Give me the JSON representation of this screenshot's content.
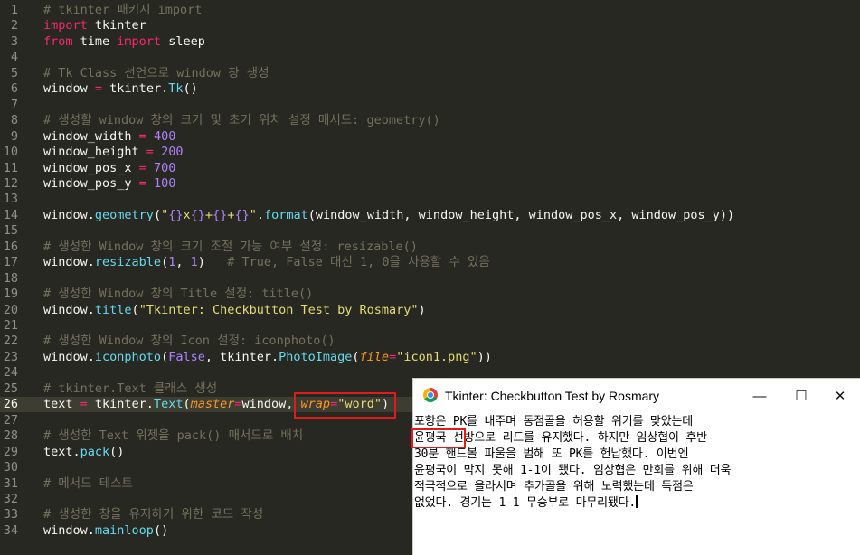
{
  "editor": {
    "line_numbers": [
      "1",
      "2",
      "3",
      "4",
      "5",
      "6",
      "7",
      "8",
      "9",
      "10",
      "11",
      "12",
      "13",
      "14",
      "15",
      "16",
      "17",
      "18",
      "19",
      "20",
      "21",
      "22",
      "23",
      "24",
      "25",
      "26",
      "27",
      "28",
      "29",
      "30",
      "31",
      "32",
      "33",
      "34"
    ],
    "active_line": 26,
    "lines": [
      [
        {
          "c": "c",
          "t": "# tkinter 패키지 import"
        }
      ],
      [
        {
          "c": "k",
          "t": "import"
        },
        {
          "c": "p",
          "t": " tkinter"
        }
      ],
      [
        {
          "c": "k",
          "t": "from"
        },
        {
          "c": "p",
          "t": " time "
        },
        {
          "c": "k",
          "t": "import"
        },
        {
          "c": "p",
          "t": " sleep"
        }
      ],
      [],
      [
        {
          "c": "c",
          "t": "# Tk Class 선언으로 window 창 생성"
        }
      ],
      [
        {
          "c": "p",
          "t": "window "
        },
        {
          "c": "k",
          "t": "="
        },
        {
          "c": "p",
          "t": " tkinter."
        },
        {
          "c": "f",
          "t": "Tk"
        },
        {
          "c": "p",
          "t": "()"
        }
      ],
      [],
      [
        {
          "c": "c",
          "t": "# 생성할 window 창의 크기 및 초기 위치 설정 매서드: geometry()"
        }
      ],
      [
        {
          "c": "p",
          "t": "window_width "
        },
        {
          "c": "k",
          "t": "="
        },
        {
          "c": "p",
          "t": " "
        },
        {
          "c": "n",
          "t": "400"
        }
      ],
      [
        {
          "c": "p",
          "t": "window_height "
        },
        {
          "c": "k",
          "t": "="
        },
        {
          "c": "p",
          "t": " "
        },
        {
          "c": "n",
          "t": "200"
        }
      ],
      [
        {
          "c": "p",
          "t": "window_pos_x "
        },
        {
          "c": "k",
          "t": "="
        },
        {
          "c": "p",
          "t": " "
        },
        {
          "c": "n",
          "t": "700"
        }
      ],
      [
        {
          "c": "p",
          "t": "window_pos_y "
        },
        {
          "c": "k",
          "t": "="
        },
        {
          "c": "p",
          "t": " "
        },
        {
          "c": "n",
          "t": "100"
        }
      ],
      [],
      [
        {
          "c": "p",
          "t": "window."
        },
        {
          "c": "f",
          "t": "geometry"
        },
        {
          "c": "p",
          "t": "("
        },
        {
          "c": "s",
          "t": "\""
        },
        {
          "c": "n",
          "t": "{}"
        },
        {
          "c": "s",
          "t": "x"
        },
        {
          "c": "n",
          "t": "{}"
        },
        {
          "c": "s",
          "t": "+"
        },
        {
          "c": "n",
          "t": "{}"
        },
        {
          "c": "s",
          "t": "+"
        },
        {
          "c": "n",
          "t": "{}"
        },
        {
          "c": "s",
          "t": "\""
        },
        {
          "c": "p",
          "t": "."
        },
        {
          "c": "f",
          "t": "format"
        },
        {
          "c": "p",
          "t": "(window_width, window_height, window_pos_x, window_pos_y))"
        }
      ],
      [],
      [
        {
          "c": "c",
          "t": "# 생성한 Window 창의 크기 조절 가능 여부 설정: resizable()"
        }
      ],
      [
        {
          "c": "p",
          "t": "window."
        },
        {
          "c": "f",
          "t": "resizable"
        },
        {
          "c": "p",
          "t": "("
        },
        {
          "c": "n",
          "t": "1"
        },
        {
          "c": "p",
          "t": ", "
        },
        {
          "c": "n",
          "t": "1"
        },
        {
          "c": "p",
          "t": ")   "
        },
        {
          "c": "c",
          "t": "# True, False 대신 1, 0을 사용할 수 있음"
        }
      ],
      [],
      [
        {
          "c": "c",
          "t": "# 생성한 Window 창의 Title 설정: title()"
        }
      ],
      [
        {
          "c": "p",
          "t": "window."
        },
        {
          "c": "f",
          "t": "title"
        },
        {
          "c": "p",
          "t": "("
        },
        {
          "c": "s",
          "t": "\"Tkinter: Checkbutton Test by Rosmary\""
        },
        {
          "c": "p",
          "t": ")"
        }
      ],
      [],
      [
        {
          "c": "c",
          "t": "# 생성한 Window 창의 Icon 설정: iconphoto()"
        }
      ],
      [
        {
          "c": "p",
          "t": "window."
        },
        {
          "c": "f",
          "t": "iconphoto"
        },
        {
          "c": "p",
          "t": "("
        },
        {
          "c": "n",
          "t": "False"
        },
        {
          "c": "p",
          "t": ", tkinter."
        },
        {
          "c": "f",
          "t": "PhotoImage"
        },
        {
          "c": "p",
          "t": "("
        },
        {
          "c": "a",
          "t": "file"
        },
        {
          "c": "k",
          "t": "="
        },
        {
          "c": "s",
          "t": "\"icon1.png\""
        },
        {
          "c": "p",
          "t": "))"
        }
      ],
      [],
      [
        {
          "c": "c",
          "t": "# tkinter.Text 클래스 생성"
        }
      ],
      [
        {
          "c": "p",
          "t": "text "
        },
        {
          "c": "k",
          "t": "="
        },
        {
          "c": "p",
          "t": " tkinter."
        },
        {
          "c": "f",
          "t": "Text"
        },
        {
          "c": "p",
          "t": "("
        },
        {
          "c": "a",
          "t": "master"
        },
        {
          "c": "k",
          "t": "="
        },
        {
          "c": "p",
          "t": "window, "
        },
        {
          "c": "a",
          "t": "wrap"
        },
        {
          "c": "k",
          "t": "="
        },
        {
          "c": "s",
          "t": "\"word\""
        },
        {
          "c": "p",
          "t": ")"
        }
      ],
      [],
      [
        {
          "c": "c",
          "t": "# 생성한 Text 위젯을 pack() 매서드로 배치"
        }
      ],
      [
        {
          "c": "p",
          "t": "text."
        },
        {
          "c": "f",
          "t": "pack"
        },
        {
          "c": "p",
          "t": "()"
        }
      ],
      [],
      [
        {
          "c": "c",
          "t": "# 메서드 테스트"
        }
      ],
      [],
      [
        {
          "c": "c",
          "t": "# 생성한 창을 유지하기 위한 코드 작성"
        }
      ],
      [
        {
          "c": "p",
          "t": "window."
        },
        {
          "c": "f",
          "t": "mainloop"
        },
        {
          "c": "p",
          "t": "()"
        }
      ]
    ]
  },
  "tk_window": {
    "title": "Tkinter: Checkbutton Test by Rosmary",
    "minimize_glyph": "—",
    "maximize_glyph": "☐",
    "close_glyph": "✕",
    "text_lines": [
      "포항은 PK를 내주며 동점골을 허용할 위기를 맞았는데",
      "윤평국 선방으로 리드를 유지했다. 하지만 임상협이 후반",
      "30분 핸드볼 파울을 범해 또 PK를 헌납했다. 이번엔",
      "윤평국이 막지 못해 1-1이 됐다. 임상협은 만회를 위해 더욱",
      "적극적으로 올라서며 추가골을 위해 노력했는데 득점은",
      "없었다. 경기는 1-1 무승부로 마무리됐다."
    ]
  },
  "colors": {
    "editor_bg": "#272822",
    "comment": "#75715e",
    "keyword": "#f92672",
    "number": "#ae81ff",
    "string": "#e6db74",
    "function": "#66d9ef",
    "argument": "#fd971f",
    "highlight_box": "#e01b1b"
  }
}
